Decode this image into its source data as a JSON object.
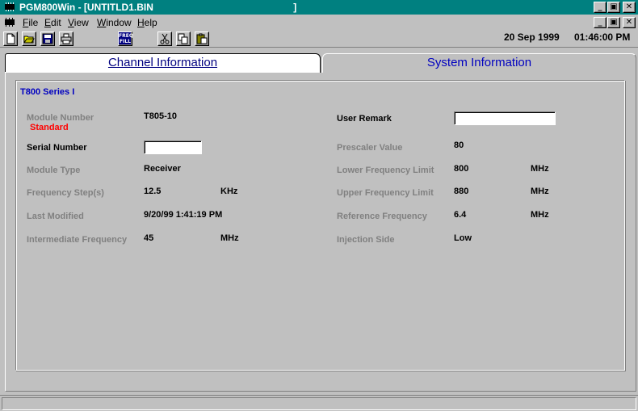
{
  "window": {
    "title": "PGM800Win - [UNTITLD1.BIN                                                    ]",
    "minimize": "_",
    "restore": "▣",
    "close": "✕"
  },
  "menu": {
    "items": [
      {
        "underline": "F",
        "rest": "ile"
      },
      {
        "underline": "E",
        "rest": "dit"
      },
      {
        "underline": "V",
        "rest": "iew"
      },
      {
        "underline": "W",
        "rest": "indow"
      },
      {
        "underline": "H",
        "rest": "elp"
      }
    ]
  },
  "toolbar": {
    "buttons": [
      "new-icon",
      "open-icon",
      "save-icon",
      "print-icon",
      "freq-fill-icon",
      "cut-icon",
      "copy-icon",
      "paste-icon"
    ],
    "freq_fill_line1": "FREQ",
    "freq_fill_line2": "FILL",
    "date": "20 Sep 1999",
    "time": "01:46:00 PM"
  },
  "tabs": {
    "channel": "Channel Information",
    "system": "System Information"
  },
  "group": {
    "title": "T800 Series I"
  },
  "left": {
    "module_number_label": "Module Number",
    "module_number_value": "T805-10",
    "module_number_note": "Standard",
    "serial_number_label": "Serial Number",
    "serial_number_value": "",
    "module_type_label": "Module Type",
    "module_type_value": "Receiver",
    "freq_step_label": "Frequency Step(s)",
    "freq_step_value": "12.5",
    "freq_step_unit": "KHz",
    "last_modified_label": "Last Modified",
    "last_modified_value": "9/20/99 1:41:19 PM",
    "if_label": "Intermediate Frequency",
    "if_value": "45",
    "if_unit": "MHz"
  },
  "right": {
    "user_remark_label": "User Remark",
    "user_remark_value": "",
    "prescaler_label": "Prescaler Value",
    "prescaler_value": "80",
    "lower_label": "Lower Frequency Limit",
    "lower_value": "800",
    "lower_unit": "MHz",
    "upper_label": "Upper Frequency Limit",
    "upper_value": "880",
    "upper_unit": "MHz",
    "ref_label": "Reference Frequency",
    "ref_value": "6.4",
    "ref_unit": "MHz",
    "injection_label": "Injection Side",
    "injection_value": "Low"
  }
}
